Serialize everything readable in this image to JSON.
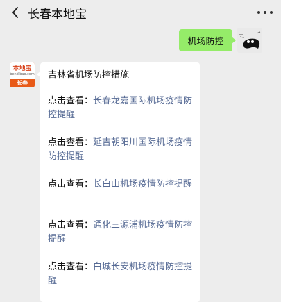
{
  "header": {
    "title": "长春本地宝"
  },
  "outgoing": {
    "text": "机场防控"
  },
  "bot_avatar": {
    "main": "本地宝",
    "sub": "bendibao.com",
    "city": "长春"
  },
  "card": {
    "title": "吉林省机场防控措施",
    "prefix": "点击查看：",
    "items": [
      {
        "link": "长春龙嘉国际机场疫情防控提醒"
      },
      {
        "link": "延吉朝阳川国际机场疫情防控提醒"
      },
      {
        "link": "长白山机场疫情防控提醒"
      },
      {
        "link": "通化三源浦机场疫情防控提醒"
      },
      {
        "link": "白城长安机场疫情防控提醒"
      }
    ]
  },
  "colors": {
    "background": "#ededed",
    "outgoing_bubble": "#95ec69",
    "link": "#576b95",
    "brand": "#e85a18"
  },
  "icons": {
    "back": "chevron-left-icon",
    "more": "more-dots-icon"
  }
}
